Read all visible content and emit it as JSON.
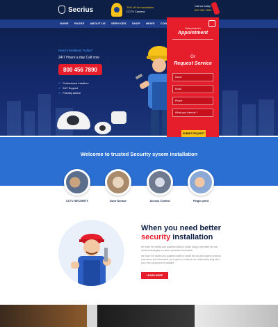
{
  "header": {
    "brand": "Secrius",
    "promo_line1": "20% off for installation",
    "promo_line2": "CCTV Camera",
    "call_label": "Call us today",
    "call_number": "800 456 7890"
  },
  "nav": [
    "HOME",
    "PAGES",
    "ABOUT US",
    "SERVICES",
    "SHOP",
    "NEWS",
    "CONTACT"
  ],
  "hero": {
    "kicker": "Need Installation Today?",
    "subtitle": "24/7 Hours a day Call now",
    "phone": "800 456 7890",
    "features": [
      "Professional Installers",
      "24/7 Support",
      "Friendly Advice"
    ]
  },
  "form": {
    "schedule": "Schedule An",
    "appointment": "Appointment",
    "or": "Or",
    "request": "Request Service",
    "fields": [
      "Name",
      "Email",
      "Phone",
      "What your Interest ?"
    ],
    "submit": "SUBMIT REQUEST"
  },
  "welcome": {
    "title": "Welcome to trusted Security sysem installation"
  },
  "services": [
    "CCTV SECURITY",
    "Door Sensor",
    "Access Control",
    "Finger print"
  ],
  "about": {
    "title_line1": "When you need better",
    "title_red": "security",
    "title_line2": "installation",
    "p1": "We have the skilled and qualified staffs to install bring to the table win-win survival strategies to ensure proactive domination.",
    "p2": "We have the skilled and qualified staffs to install the security system protects your place and introduced, we expect to continue our relationship long after your new equipment is installed.",
    "button": "LEARN MORE"
  },
  "colors": {
    "navy": "#0d1f45",
    "blue": "#1f3c88",
    "accent_blue": "#2a6fd1",
    "red": "#e61e2b",
    "yellow": "#f6c21a"
  }
}
